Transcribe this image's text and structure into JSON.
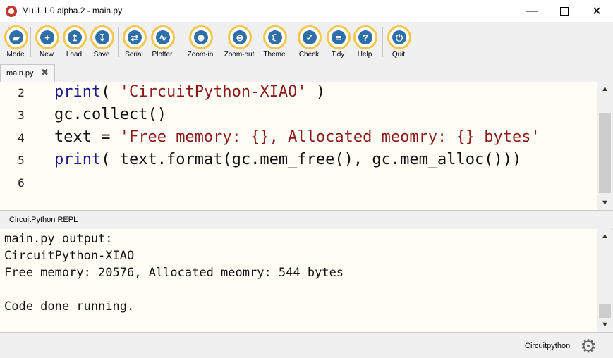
{
  "window": {
    "title": "Mu 1.1.0.alpha.2 - main.py",
    "minimize": "—",
    "close": "✕"
  },
  "toolbar": {
    "buttons": [
      {
        "label": "Mode",
        "glyph": "▰"
      },
      {
        "label": "New",
        "glyph": "+"
      },
      {
        "label": "Load",
        "glyph": "↥"
      },
      {
        "label": "Save",
        "glyph": "↧"
      },
      {
        "label": "Serial",
        "glyph": "⇄"
      },
      {
        "label": "Plotter",
        "glyph": "∿"
      },
      {
        "label": "Zoom-in",
        "glyph": "⊕"
      },
      {
        "label": "Zoom-out",
        "glyph": "⊖"
      },
      {
        "label": "Theme",
        "glyph": "☾"
      },
      {
        "label": "Check",
        "glyph": "✓"
      },
      {
        "label": "Tidy",
        "glyph": "≡"
      },
      {
        "label": "Help",
        "glyph": "?"
      },
      {
        "label": "Quit",
        "glyph": "⏻"
      }
    ]
  },
  "tabs": [
    {
      "label": "main.py",
      "close": "✖"
    }
  ],
  "editor": {
    "lines": [
      {
        "number": "2",
        "parts": [
          {
            "t": "print",
            "c": "kw"
          },
          {
            "t": "( ",
            "c": ""
          },
          {
            "t": "'CircuitPython-XIAO'",
            "c": "str"
          },
          {
            "t": " )",
            "c": ""
          }
        ]
      },
      {
        "number": "3",
        "parts": [
          {
            "t": "gc.collect()",
            "c": ""
          }
        ]
      },
      {
        "number": "4",
        "parts": [
          {
            "t": "text = ",
            "c": ""
          },
          {
            "t": "'Free memory: {}, Allocated meomry: {} bytes'",
            "c": "str"
          }
        ]
      },
      {
        "number": "5",
        "parts": [
          {
            "t": "print",
            "c": "kw"
          },
          {
            "t": "( text.format(gc.mem_free(), gc.mem_alloc()))",
            "c": ""
          }
        ]
      },
      {
        "number": "6",
        "parts": []
      }
    ]
  },
  "repl": {
    "title": "CircuitPython REPL",
    "lines": [
      "main.py output:",
      "CircuitPython-XIAO",
      "Free memory: 20576, Allocated meomry: 544 bytes",
      "",
      "Code done running."
    ]
  },
  "statusbar": {
    "mode": "Circuitpython",
    "settings_glyph": "⚙"
  },
  "colors": {
    "accent": "#f4c64b",
    "icon": "#2f6fa8",
    "editor_bg": "#fefef7",
    "keyword": "#1a1a8c",
    "string": "#8b1a1a"
  }
}
